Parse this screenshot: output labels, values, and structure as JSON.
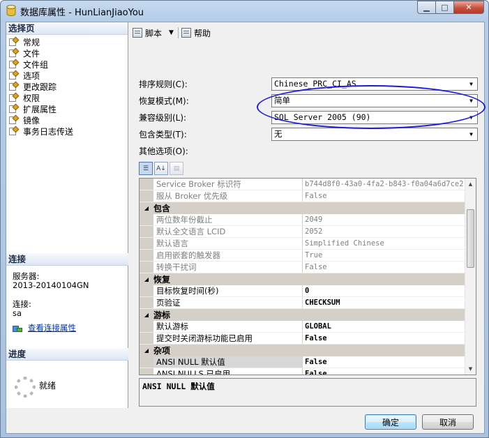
{
  "window": {
    "title": "数据库属性 - HunLianJiaoYou"
  },
  "left": {
    "select_page_heading": "选择页",
    "pages": [
      {
        "label": "常规"
      },
      {
        "label": "文件"
      },
      {
        "label": "文件组"
      },
      {
        "label": "选项"
      },
      {
        "label": "更改跟踪"
      },
      {
        "label": "权限"
      },
      {
        "label": "扩展属性"
      },
      {
        "label": "镜像"
      },
      {
        "label": "事务日志传送"
      }
    ],
    "connection_heading": "连接",
    "server_label": "服务器:",
    "server_value": "2013-20140104GN",
    "connection_label": "连接:",
    "connection_value": "sa",
    "view_connection_link": "查看连接属性",
    "progress_heading": "进度",
    "progress_status": "就绪"
  },
  "toolbar": {
    "script_label": "脚本",
    "help_label": "帮助"
  },
  "options": {
    "collation_label": "排序规则(C):",
    "collation_value": "Chinese_PRC_CI_AS",
    "recovery_label": "恢复模式(M):",
    "recovery_value": "简单",
    "compat_label": "兼容级别(L):",
    "compat_value": "SQL Server 2005 (90)",
    "containment_label": "包含类型(T):",
    "containment_value": "无",
    "other_label": "其他选项(O):"
  },
  "property_grid": {
    "rows": [
      {
        "kind": "prop",
        "name": "Service Broker 标识符",
        "value": "b744d8f0-43a0-4fa2-b843-f0a04a6d7ce2",
        "readonly": true
      },
      {
        "kind": "prop",
        "name": "服从 Broker 优先级",
        "value": "False",
        "readonly": true
      },
      {
        "kind": "cat",
        "name": "包含"
      },
      {
        "kind": "prop",
        "name": "两位数年份截止",
        "value": "2049",
        "readonly": true
      },
      {
        "kind": "prop",
        "name": "默认全文语言 LCID",
        "value": "2052",
        "readonly": true
      },
      {
        "kind": "prop",
        "name": "默认语言",
        "value": "Simplified Chinese",
        "readonly": true
      },
      {
        "kind": "prop",
        "name": "启用嵌套的触发器",
        "value": "True",
        "readonly": true
      },
      {
        "kind": "prop",
        "name": "转换干扰词",
        "value": "False",
        "readonly": true
      },
      {
        "kind": "cat",
        "name": "恢复"
      },
      {
        "kind": "prop",
        "name": "目标恢复时间(秒)",
        "value": "0",
        "readonly": false
      },
      {
        "kind": "prop",
        "name": "页验证",
        "value": "CHECKSUM",
        "readonly": false
      },
      {
        "kind": "cat",
        "name": "游标"
      },
      {
        "kind": "prop",
        "name": "默认游标",
        "value": "GLOBAL",
        "readonly": false
      },
      {
        "kind": "prop",
        "name": "提交时关闭游标功能已启用",
        "value": "False",
        "readonly": false
      },
      {
        "kind": "cat",
        "name": "杂项"
      },
      {
        "kind": "prop",
        "name": "ANSI NULL 默认值",
        "value": "False",
        "readonly": false,
        "selected": true
      },
      {
        "kind": "prop",
        "name": "ANSI NULLS 已启用",
        "value": "False",
        "readonly": false
      }
    ],
    "description": "ANSI NULL 默认值"
  },
  "buttons": {
    "ok": "确定",
    "cancel": "取消"
  },
  "colors": {
    "highlight_ellipse": "#1a1ae0",
    "link": "#0033aa"
  }
}
